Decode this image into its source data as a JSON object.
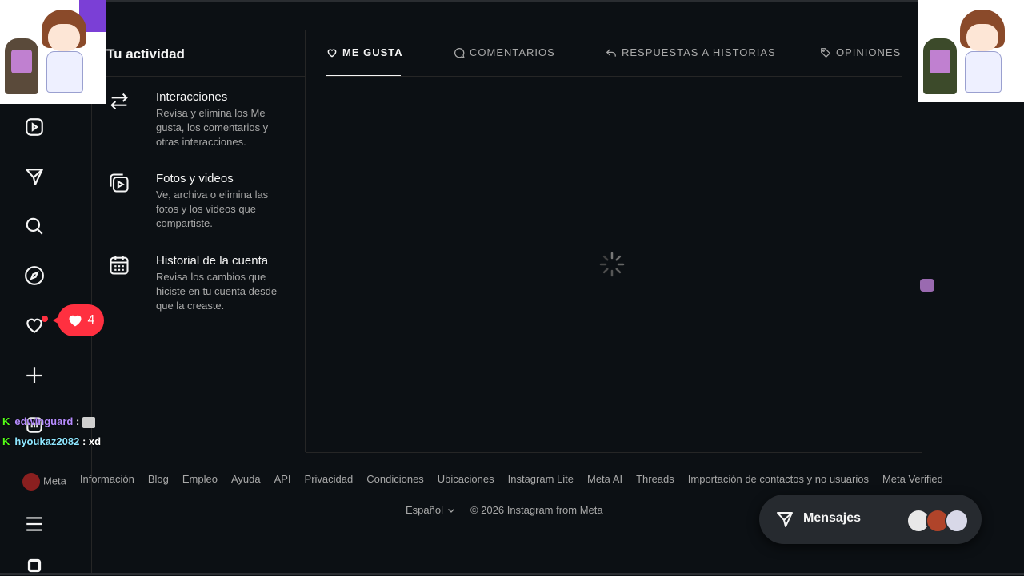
{
  "activity": {
    "title": "Tu actividad",
    "items": [
      {
        "title": "Interacciones",
        "desc": "Revisa y elimina los Me gusta, los comentarios y otras interacciones."
      },
      {
        "title": "Fotos y videos",
        "desc": "Ve, archiva o elimina las fotos y los videos que compartiste."
      },
      {
        "title": "Historial de la cuenta",
        "desc": "Revisa los cambios que hiciste en tu cuenta desde que la creaste."
      }
    ]
  },
  "tabs": [
    {
      "label": "ME GUSTA",
      "icon": "heart-icon",
      "active": true
    },
    {
      "label": "COMENTARIOS",
      "icon": "comment-icon",
      "active": false
    },
    {
      "label": "RESPUESTAS A HISTORIAS",
      "icon": "reply-icon",
      "active": false
    },
    {
      "label": "OPINIONES",
      "icon": "tag-icon",
      "active": false
    }
  ],
  "notifications": {
    "count": "4"
  },
  "chat": [
    {
      "user": "edwinguard",
      "msg": ":"
    },
    {
      "user": "hyoukaz2082",
      "msg": ": xd"
    }
  ],
  "footer": {
    "links": [
      "Meta",
      "Información",
      "Blog",
      "Empleo",
      "Ayuda",
      "API",
      "Privacidad",
      "Condiciones",
      "Ubicaciones",
      "Instagram Lite",
      "Meta AI",
      "Threads",
      "Importación de contactos y no usuarios",
      "Meta Verified"
    ],
    "language": "Español",
    "copyright": "© 2026 Instagram from Meta"
  },
  "messages": {
    "label": "Mensajes"
  },
  "colors": {
    "background": "#0c1014",
    "notification": "#ff3040",
    "muted": "#a8a8a8"
  }
}
